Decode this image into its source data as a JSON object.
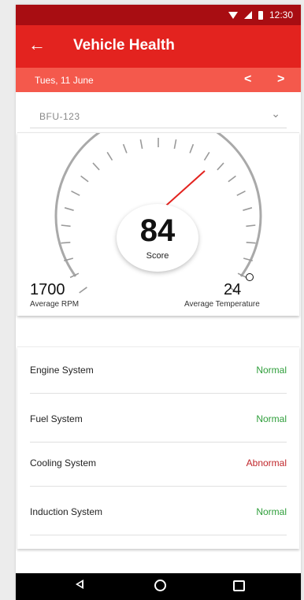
{
  "status_bar": {
    "time": "12:30"
  },
  "app_bar": {
    "back_icon": "arrow-left-icon",
    "title": "Vehicle Health"
  },
  "date_bar": {
    "date": "Tues, 11 June",
    "prev": "<",
    "next": ">"
  },
  "vehicle_select": {
    "value": "BFU-123",
    "icon": "chevron-down-icon"
  },
  "gauge": {
    "score": "84",
    "score_label": "Score",
    "rpm_value": "1700",
    "rpm_label": "Average RPM",
    "temp_value": "24",
    "temp_label": "Average Temperature",
    "needle_color": "#e3231f"
  },
  "systems": [
    {
      "name": "Engine System",
      "status": "Normal",
      "status_color": "#2e9e3a"
    },
    {
      "name": "Fuel System",
      "status": "Normal",
      "status_color": "#2e9e3a"
    },
    {
      "name": "Cooling System",
      "status": "Abnormal",
      "status_color": "#c0262b"
    },
    {
      "name": "Induction System",
      "status": "Normal",
      "status_color": "#2e9e3a"
    }
  ],
  "colors": {
    "status_bar": "#a80d12",
    "app_bar": "#e3231f",
    "date_bar": "#f4594c"
  }
}
